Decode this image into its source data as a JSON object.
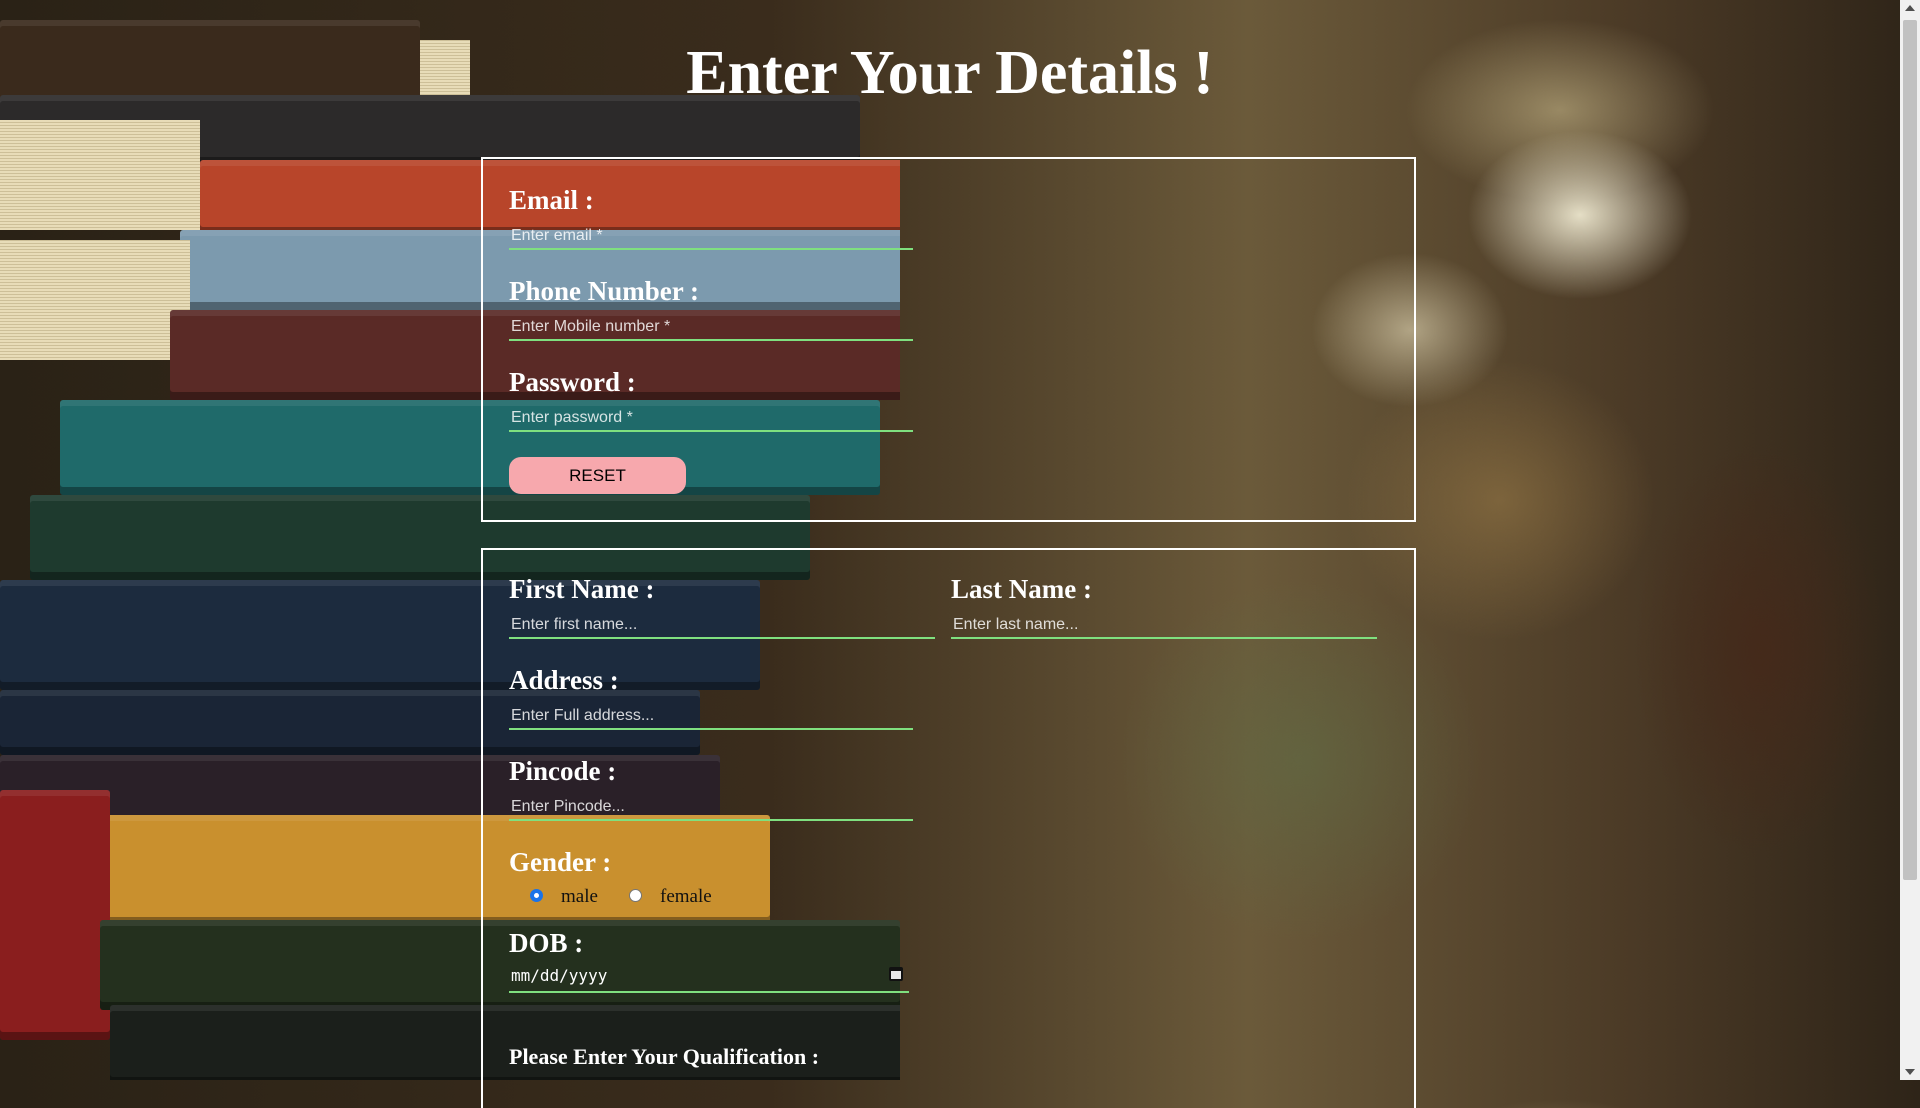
{
  "title": "Enter Your Details !",
  "account_section": {
    "email": {
      "label": "Email :",
      "placeholder": "Enter email *",
      "value": ""
    },
    "phone": {
      "label": "Phone Number :",
      "placeholder": "Enter Mobile number *",
      "value": ""
    },
    "password": {
      "label": "Password :",
      "placeholder": "Enter password *",
      "value": ""
    },
    "reset_label": "RESET"
  },
  "personal_section": {
    "first_name": {
      "label": "First Name :",
      "placeholder": "Enter first name...",
      "value": ""
    },
    "last_name": {
      "label": "Last Name :",
      "placeholder": "Enter last name...",
      "value": ""
    },
    "address": {
      "label": "Address :",
      "placeholder": "Enter Full address...",
      "value": ""
    },
    "pincode": {
      "label": "Pincode :",
      "placeholder": "Enter Pincode...",
      "value": ""
    },
    "gender": {
      "label": "Gender :",
      "options": [
        "male",
        "female"
      ],
      "selected": "male"
    },
    "dob": {
      "label": "DOB :",
      "placeholder": "mm/dd/yyyy",
      "icon": "calendar-icon"
    },
    "qualification_heading": "Please Enter Your Qualification :"
  },
  "colors": {
    "input_underline": "#7fe07f",
    "reset_button": "#f7a8ad",
    "radio_selected": "#1a73e8"
  }
}
